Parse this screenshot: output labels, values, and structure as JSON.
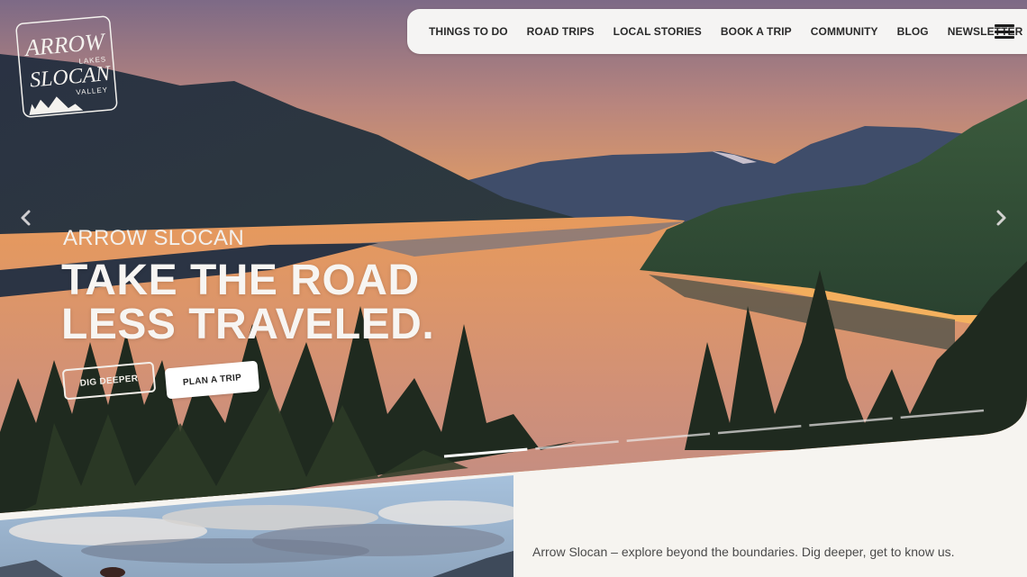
{
  "logo": {
    "line1": "ARROW",
    "line2": "LAKES",
    "line3": "SLOCAN",
    "line4": "VALLEY",
    "icon": "mountain-logo-icon"
  },
  "nav": {
    "items": [
      {
        "label": "THINGS TO DO"
      },
      {
        "label": "ROAD TRIPS"
      },
      {
        "label": "LOCAL STORIES"
      },
      {
        "label": "BOOK A TRIP"
      },
      {
        "label": "COMMUNITY"
      },
      {
        "label": "BLOG"
      },
      {
        "label": "NEWSLETTER"
      }
    ],
    "menu_icon": "hamburger-menu-icon"
  },
  "hero": {
    "eyebrow": "ARROW SLOCAN",
    "title_line1": "TAKE THE ROAD",
    "title_line2": "LESS TRAVELED.",
    "buttons": {
      "secondary": "DIG DEEPER",
      "primary": "PLAN A TRIP"
    },
    "prev_icon": "chevron-left-icon",
    "next_icon": "chevron-right-icon",
    "slides": {
      "count": 6,
      "active": 1
    }
  },
  "intro": {
    "text": "Arrow Slocan – explore beyond the boundaries. Dig deeper, get to know us."
  },
  "colors": {
    "nav_bg": "#f5f4f3",
    "page_bg": "#f6f4f0",
    "text_dark": "#2a2a2a",
    "sky_orange": "#f0a45a",
    "sky_mauve": "#8a6a84"
  }
}
